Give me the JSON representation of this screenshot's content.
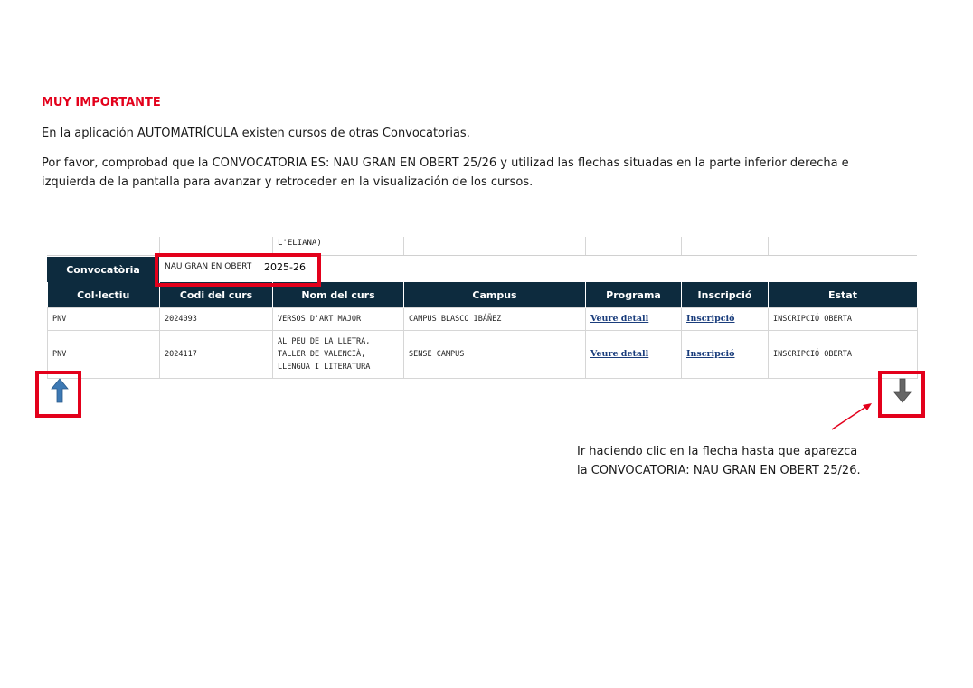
{
  "heading": "MUY IMPORTANTE",
  "paragraph1": "En la aplicación AUTOMATRÍCULA existen cursos de otras Convocatorias.",
  "paragraph2": "Por favor, comprobad que la CONVOCATORIA ES: NAU GRAN EN OBERT 25/26 y utilizad las flechas situadas en la parte inferior derecha e izquierda de la pantalla para avanzar y retroceder en la visualización de los cursos.",
  "cropped_text": "L'ELIANA)",
  "convocatoria": {
    "label": "Convocatòria",
    "value": "NAU GRAN EN OBERT",
    "year_overlay": "2025-26"
  },
  "table": {
    "headers": [
      "Col·lectiu",
      "Codi del curs",
      "Nom del curs",
      "Campus",
      "Programa",
      "Inscripció",
      "Estat"
    ],
    "rows": [
      {
        "collectiu": "PNV",
        "codi": "2024093",
        "nom": "VERSOS D'ART MAJOR",
        "campus": "CAMPUS BLASCO IBÁÑEZ",
        "programa": "Veure detall",
        "inscripcio": "Inscripció",
        "estat": "INSCRIPCIÓ OBERTA"
      },
      {
        "collectiu": "PNV",
        "codi": "2024117",
        "nom": "AL PEU DE LA LLETRA, TALLER DE VALENCIÀ, LLENGUA I LITERATURA",
        "campus": "SENSE CAMPUS",
        "programa": "Veure detall",
        "inscripcio": "Inscripció",
        "estat": "INSCRIPCIÓ OBERTA"
      }
    ]
  },
  "note": {
    "line1": "Ir haciendo clic en la flecha hasta que aparezca",
    "line2": "la CONVOCATORIA: NAU GRAN EN OBERT 25/26."
  },
  "icons": {
    "up": "arrow-up-icon",
    "down": "arrow-down-icon",
    "pointer": "pointer-arrow-icon"
  },
  "colors": {
    "accent_red": "#e3001b",
    "header_navy": "#0d2b3e",
    "up_arrow": "#3d79b4",
    "down_arrow": "#666666",
    "link": "#1a3d7c"
  }
}
